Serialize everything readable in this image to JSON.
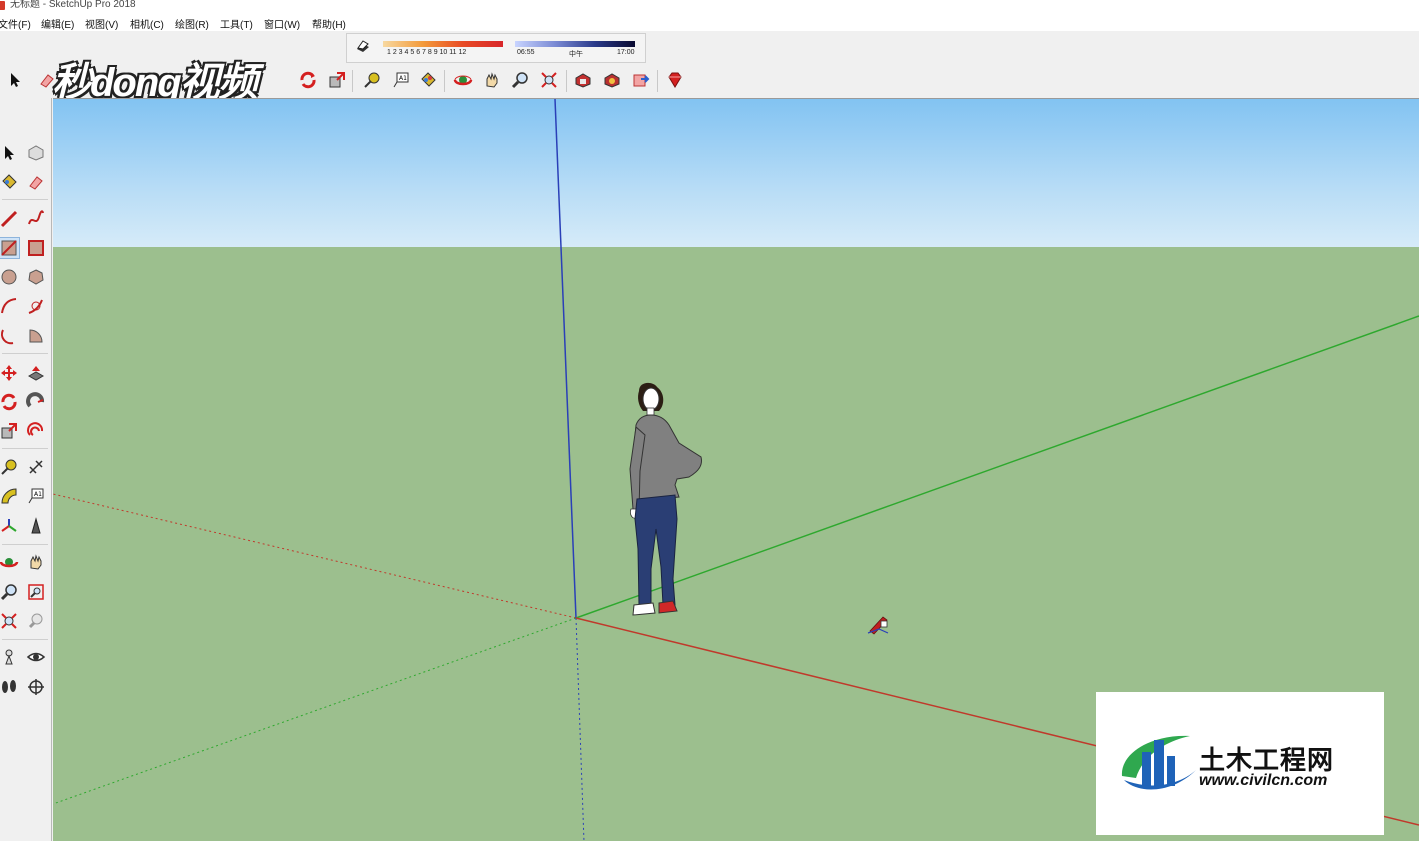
{
  "window": {
    "title": "无标题 - SketchUp Pro 2018"
  },
  "menu": [
    {
      "label": "文件(F)"
    },
    {
      "label": "编辑(E)"
    },
    {
      "label": "视图(V)"
    },
    {
      "label": "相机(C)"
    },
    {
      "label": "绘图(R)"
    },
    {
      "label": "工具(T)"
    },
    {
      "label": "窗口(W)"
    },
    {
      "label": "帮助(H)"
    }
  ],
  "shadows": {
    "months": "1 2 3 4 5 6 7 8 9 10 11 12",
    "time_start": "06:55",
    "time_mid": "中午",
    "time_end": "17:00"
  },
  "watermark": {
    "text": "秒dong视频"
  },
  "logo": {
    "name": "土木工程网",
    "url": "www.civilcn.com"
  },
  "colors": {
    "sky": "#9fd0f4",
    "ground": "#9cbf8e",
    "axis_red": "#c0392b",
    "axis_green": "#2ea82e",
    "axis_blue": "#2a3fb8"
  },
  "icons": {
    "main_toolbar": [
      "select-icon",
      "eraser-icon",
      "rotate-icon",
      "scale-icon",
      "tape-measure-icon",
      "text-icon",
      "paint-bucket-icon",
      "orbit-icon",
      "pan-icon",
      "zoom-icon",
      "zoom-extents-icon",
      "warehouse-icon",
      "extension-warehouse-icon",
      "share-model-icon",
      "ruby-icon"
    ],
    "left_toolbar": [
      "select-icon",
      "component-icon",
      "paint-bucket-icon",
      "eraser-icon",
      "line-icon",
      "freehand-icon",
      "rectangle-icon",
      "rotated-rectangle-icon",
      "circle-icon",
      "polygon-icon",
      "arc-icon",
      "pie-icon",
      "move-icon",
      "push-pull-icon",
      "rotate-icon",
      "follow-me-icon",
      "scale-icon",
      "offset-icon",
      "tape-measure-icon",
      "dimension-icon",
      "protractor-icon",
      "text-icon",
      "axes-icon",
      "3d-text-icon",
      "orbit-icon",
      "pan-icon",
      "zoom-icon",
      "zoom-window-icon",
      "zoom-extents-icon",
      "previous-view-icon",
      "position-camera-icon",
      "look-around-icon",
      "walk-icon",
      "section-plane-icon"
    ]
  }
}
